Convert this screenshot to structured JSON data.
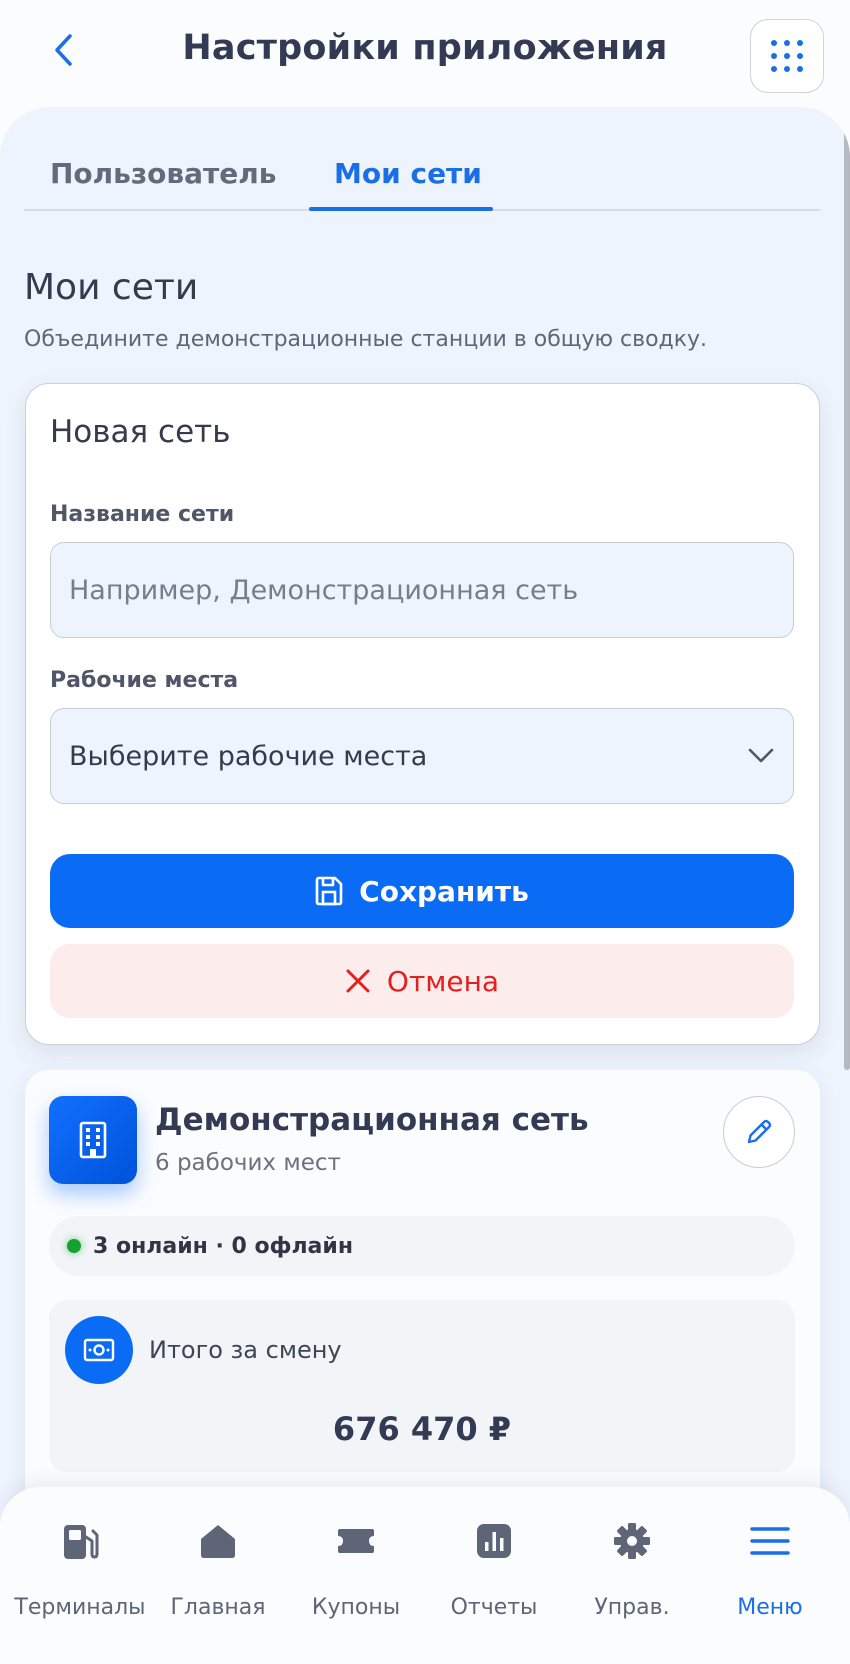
{
  "header": {
    "title": "Настройки приложения",
    "back_icon": "chevron-left-icon",
    "menu_icon": "grid-dots-icon"
  },
  "tabs": [
    {
      "label": "Пользователь",
      "active": false
    },
    {
      "label": "Мои сети",
      "active": true
    }
  ],
  "section": {
    "title": "Мои сети",
    "subtitle": "Объедините демонстрационные станции в общую сводку."
  },
  "form": {
    "title": "Новая сеть",
    "name_label": "Название сети",
    "name_placeholder": "Например, Демонстрационная сеть",
    "name_value": "",
    "places_label": "Рабочие места",
    "places_value": "Выберите рабочие места",
    "save_label": "Сохранить",
    "cancel_label": "Отмена"
  },
  "network": {
    "name": "Демонстрационная сеть",
    "places_count": "6 рабочих мест",
    "status": "3 онлайн · 0 офлайн",
    "total_label": "Итого за смену",
    "total_value": "676 470 ₽"
  },
  "bottom_nav": [
    {
      "label": "Терминалы",
      "icon": "fuel-pump-icon",
      "active": false
    },
    {
      "label": "Главная",
      "icon": "home-icon",
      "active": false
    },
    {
      "label": "Купоны",
      "icon": "ticket-icon",
      "active": false
    },
    {
      "label": "Отчеты",
      "icon": "chart-icon",
      "active": false
    },
    {
      "label": "Управ.",
      "icon": "gear-icon",
      "active": false
    },
    {
      "label": "Меню",
      "icon": "hamburger-icon",
      "active": true
    }
  ],
  "colors": {
    "accent": "#1b6fe6",
    "primary_button": "#0a6bf4",
    "cancel_bg": "#fdecec",
    "cancel_text": "#e0211f",
    "online": "#12a22d",
    "panel_bg": "#eef4fd"
  }
}
